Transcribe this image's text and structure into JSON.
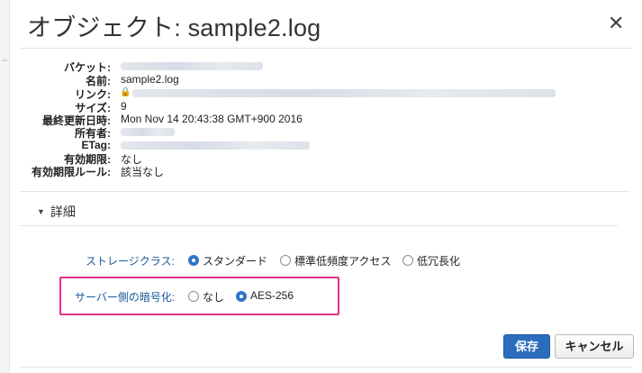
{
  "modal": {
    "title": "オブジェクト: sample2.log",
    "close_glyph": "✕"
  },
  "properties": [
    {
      "label": "バケット:",
      "value": ""
    },
    {
      "label": "名前:",
      "value": "sample2.log"
    },
    {
      "label": "リンク:",
      "value": ""
    },
    {
      "label": "サイズ:",
      "value": "9"
    },
    {
      "label": "最終更新日時:",
      "value": "Mon Nov 14 20:43:38 GMT+900 2016"
    },
    {
      "label": "所有者:",
      "value": ""
    },
    {
      "label": "ETag:",
      "value": ""
    },
    {
      "label": "有効期限:",
      "value": "なし"
    },
    {
      "label": "有効期限ルール:",
      "value": "該当なし"
    }
  ],
  "details": {
    "toggle_label": "詳細",
    "storage_class": {
      "label": "ストレージクラス:",
      "options": [
        {
          "label": "スタンダード",
          "selected": true
        },
        {
          "label": "標準低頻度アクセス",
          "selected": false
        },
        {
          "label": "低冗長化",
          "selected": false
        }
      ]
    },
    "encryption": {
      "label": "サーバー側の暗号化:",
      "options": [
        {
          "label": "なし",
          "selected": false
        },
        {
          "label": "AES-256",
          "selected": true
        }
      ]
    }
  },
  "buttons": {
    "save": "保存",
    "cancel": "キャンセル"
  },
  "colors": {
    "primary": "#2b6dbd",
    "label_blue": "#1a5a9b",
    "highlight": "#e2338a"
  }
}
